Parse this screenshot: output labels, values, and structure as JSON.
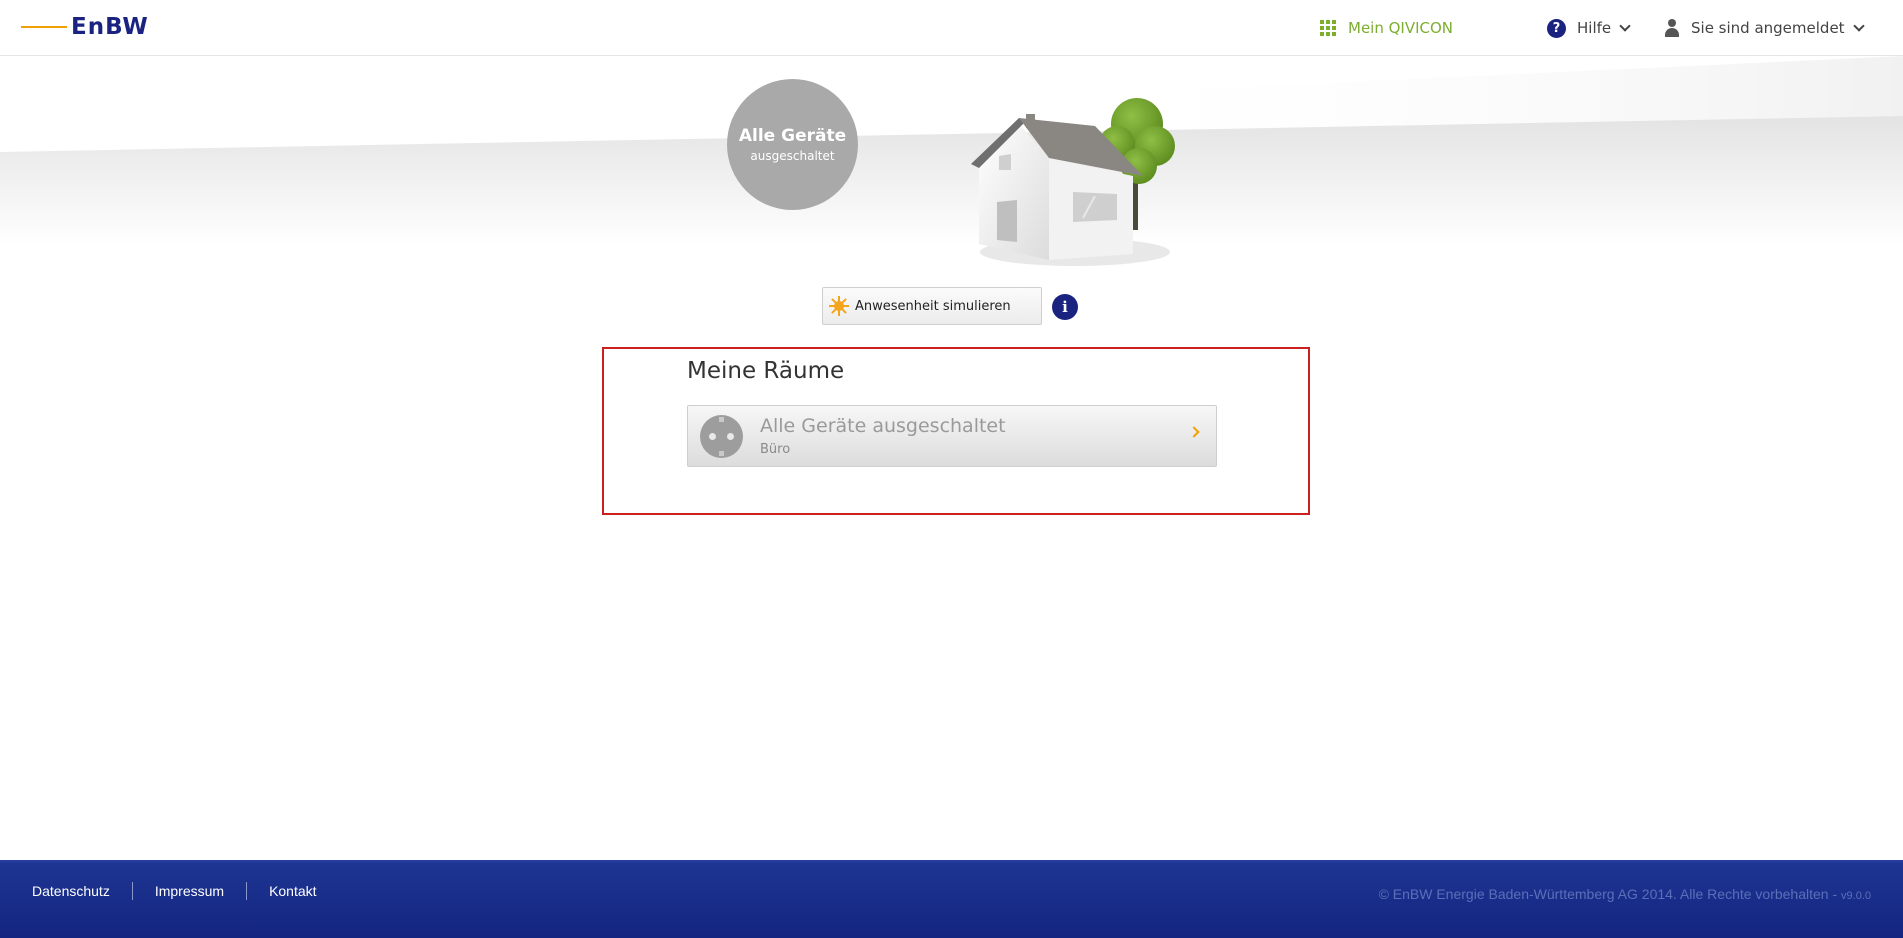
{
  "header": {
    "logo": "EnBW",
    "qivicon_label": "Mein QIVICON",
    "help_label": "Hilfe",
    "user_label": "Sie sind angemeldet"
  },
  "hero": {
    "status_title": "Alle Geräte",
    "status_subtitle": "ausgeschaltet"
  },
  "simulate": {
    "label": "Anwesenheit simulieren",
    "info": "i"
  },
  "rooms": {
    "title": "Meine Räume",
    "items": [
      {
        "status": "Alle Geräte ausgeschaltet",
        "name": "Büro"
      }
    ]
  },
  "footer": {
    "links": [
      "Datenschutz",
      "Impressum",
      "Kontakt"
    ],
    "copyright": "© EnBW Energie Baden-Württemberg AG 2014. Alle Rechte vorbehalten - ",
    "version": "v9.0.0"
  },
  "colors": {
    "brand_blue": "#1a2480",
    "accent_orange": "#f0a000",
    "qivicon_green": "#7cae2f",
    "frame_red": "#cc1f1f"
  }
}
